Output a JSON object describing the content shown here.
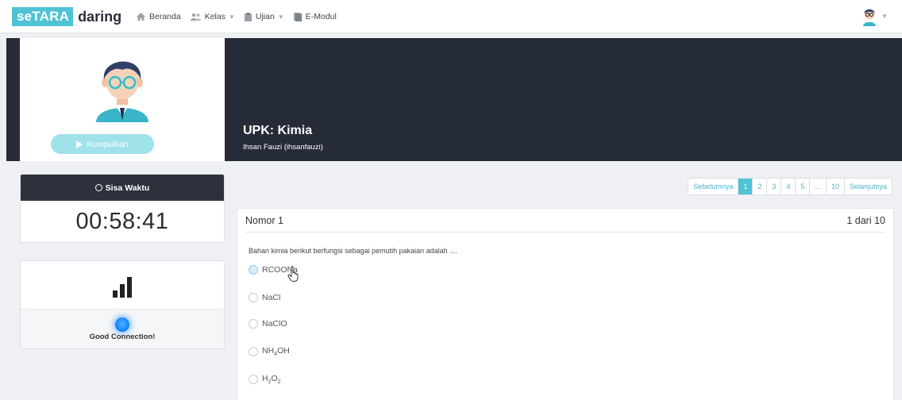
{
  "brand": {
    "prefix": "seTARA",
    "suffix": "daring"
  },
  "nav": [
    {
      "label": "Beranda",
      "icon": "home-icon",
      "dropdown": false
    },
    {
      "label": "Kelas",
      "icon": "users-icon",
      "dropdown": true
    },
    {
      "label": "Ujian",
      "icon": "clipboard-icon",
      "dropdown": true
    },
    {
      "label": "E-Modul",
      "icon": "book-icon",
      "dropdown": false
    }
  ],
  "caret": "▼",
  "exam": {
    "title": "UPK: Kimia",
    "student": "Ihsan Fauzi (ihsanfauzi)"
  },
  "submit_button": "Kumpulkan",
  "timer": {
    "label": "Sisa Waktu",
    "value": "00:58:41"
  },
  "connection": {
    "label": "Good Connection!",
    "signal_bars": 3
  },
  "pagination": {
    "prev": "Sebelumnya",
    "pages": [
      "1",
      "2",
      "3",
      "4",
      "5",
      "...",
      "10"
    ],
    "active": "1",
    "next": "Selanjutnya"
  },
  "question": {
    "number_label": "Nomor 1",
    "progress": "1 dari 10",
    "text": "Bahan kimia berikut berfungsi sebagai pemutih pakaian adalah ....",
    "options": [
      {
        "main": "RCOONa",
        "sub": "",
        "tail": ""
      },
      {
        "main": "NaCl",
        "sub": "",
        "tail": ""
      },
      {
        "main": "NaClO",
        "sub": "",
        "tail": ""
      },
      {
        "main": "NH",
        "sub": "4",
        "tail": "OH"
      },
      {
        "main": "H",
        "sub": "2",
        "tail": "O",
        "sub2": "2"
      }
    ]
  },
  "colors": {
    "accent": "#4fc3d6",
    "dark": "#262b38",
    "button": "#9fe2ea",
    "connection": "#1a8cff"
  }
}
